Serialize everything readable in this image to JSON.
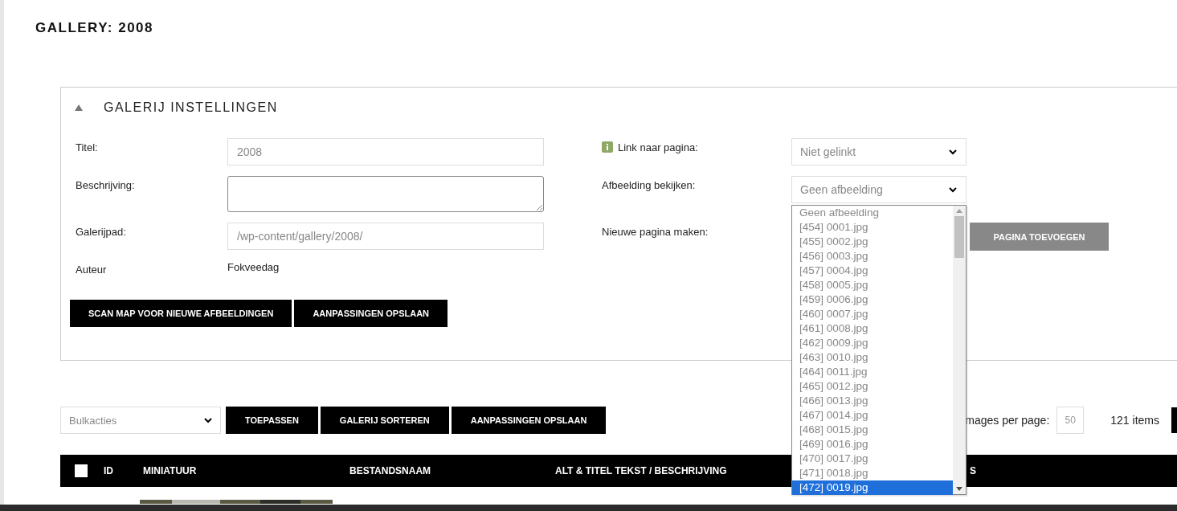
{
  "page_title": "GALLERY: 2008",
  "settings": {
    "title": "GALERIJ INSTELLINGEN",
    "expanded": true,
    "fields": [
      {
        "label": "Titel:",
        "value": "2008",
        "kind": "input"
      },
      {
        "label": "Beschrijving:",
        "kind": "textarea"
      },
      {
        "label": "Galerijpad:",
        "value": "/wp-content/gallery/2008/",
        "kind": "input"
      },
      {
        "label": "Auteur",
        "value": "Fokveedag",
        "kind": "text"
      }
    ],
    "right_fields": [
      {
        "label": "Link naar pagina:",
        "info": true,
        "value": "Niet gelinkt",
        "kind": "select"
      },
      {
        "label": "Afbeelding bekijken:",
        "info": false,
        "value": "Geen afbeelding",
        "kind": "select",
        "expanded": true
      },
      {
        "label": "Nieuwe pagina maken:",
        "info": false,
        "value": "PAGINA TOEVOEGEN",
        "kind": "button"
      }
    ],
    "buttons": [
      "SCAN MAP VOOR NIEUWE AFBEELDINGEN",
      "AANPASSINGEN OPSLAAN"
    ]
  },
  "dropdown_options": [
    {
      "label": "Geen afbeelding",
      "selected": false
    },
    {
      "label": "[454] 0001.jpg",
      "selected": false
    },
    {
      "label": "[455] 0002.jpg",
      "selected": false
    },
    {
      "label": "[456] 0003.jpg",
      "selected": false
    },
    {
      "label": "[457] 0004.jpg",
      "selected": false
    },
    {
      "label": "[458] 0005.jpg",
      "selected": false
    },
    {
      "label": "[459] 0006.jpg",
      "selected": false
    },
    {
      "label": "[460] 0007.jpg",
      "selected": false
    },
    {
      "label": "[461] 0008.jpg",
      "selected": false
    },
    {
      "label": "[462] 0009.jpg",
      "selected": false
    },
    {
      "label": "[463] 0010.jpg",
      "selected": false
    },
    {
      "label": "[464] 0011.jpg",
      "selected": false
    },
    {
      "label": "[465] 0012.jpg",
      "selected": false
    },
    {
      "label": "[466] 0013.jpg",
      "selected": false
    },
    {
      "label": "[467] 0014.jpg",
      "selected": false
    },
    {
      "label": "[468] 0015.jpg",
      "selected": false
    },
    {
      "label": "[469] 0016.jpg",
      "selected": false
    },
    {
      "label": "[470] 0017.jpg",
      "selected": false
    },
    {
      "label": "[471] 0018.jpg",
      "selected": false
    },
    {
      "label": "[472] 0019.jpg",
      "selected": true
    }
  ],
  "toolbar": {
    "bulk_select": "Bulkacties",
    "buttons": [
      "TOEPASSEN",
      "GALERIJ SORTEREN",
      "AANPASSINGEN OPSLAAN"
    ],
    "per_page_label": "mages per page:",
    "per_page": "50",
    "count": "121 items"
  },
  "table": {
    "select_all_checked": false,
    "columns": [
      "ID",
      "MINIATUUR",
      "BESTANDSNAAM",
      "ALT & TITEL TEKST / BESCHRIJVING",
      "S"
    ]
  },
  "bottom_bar": true
}
